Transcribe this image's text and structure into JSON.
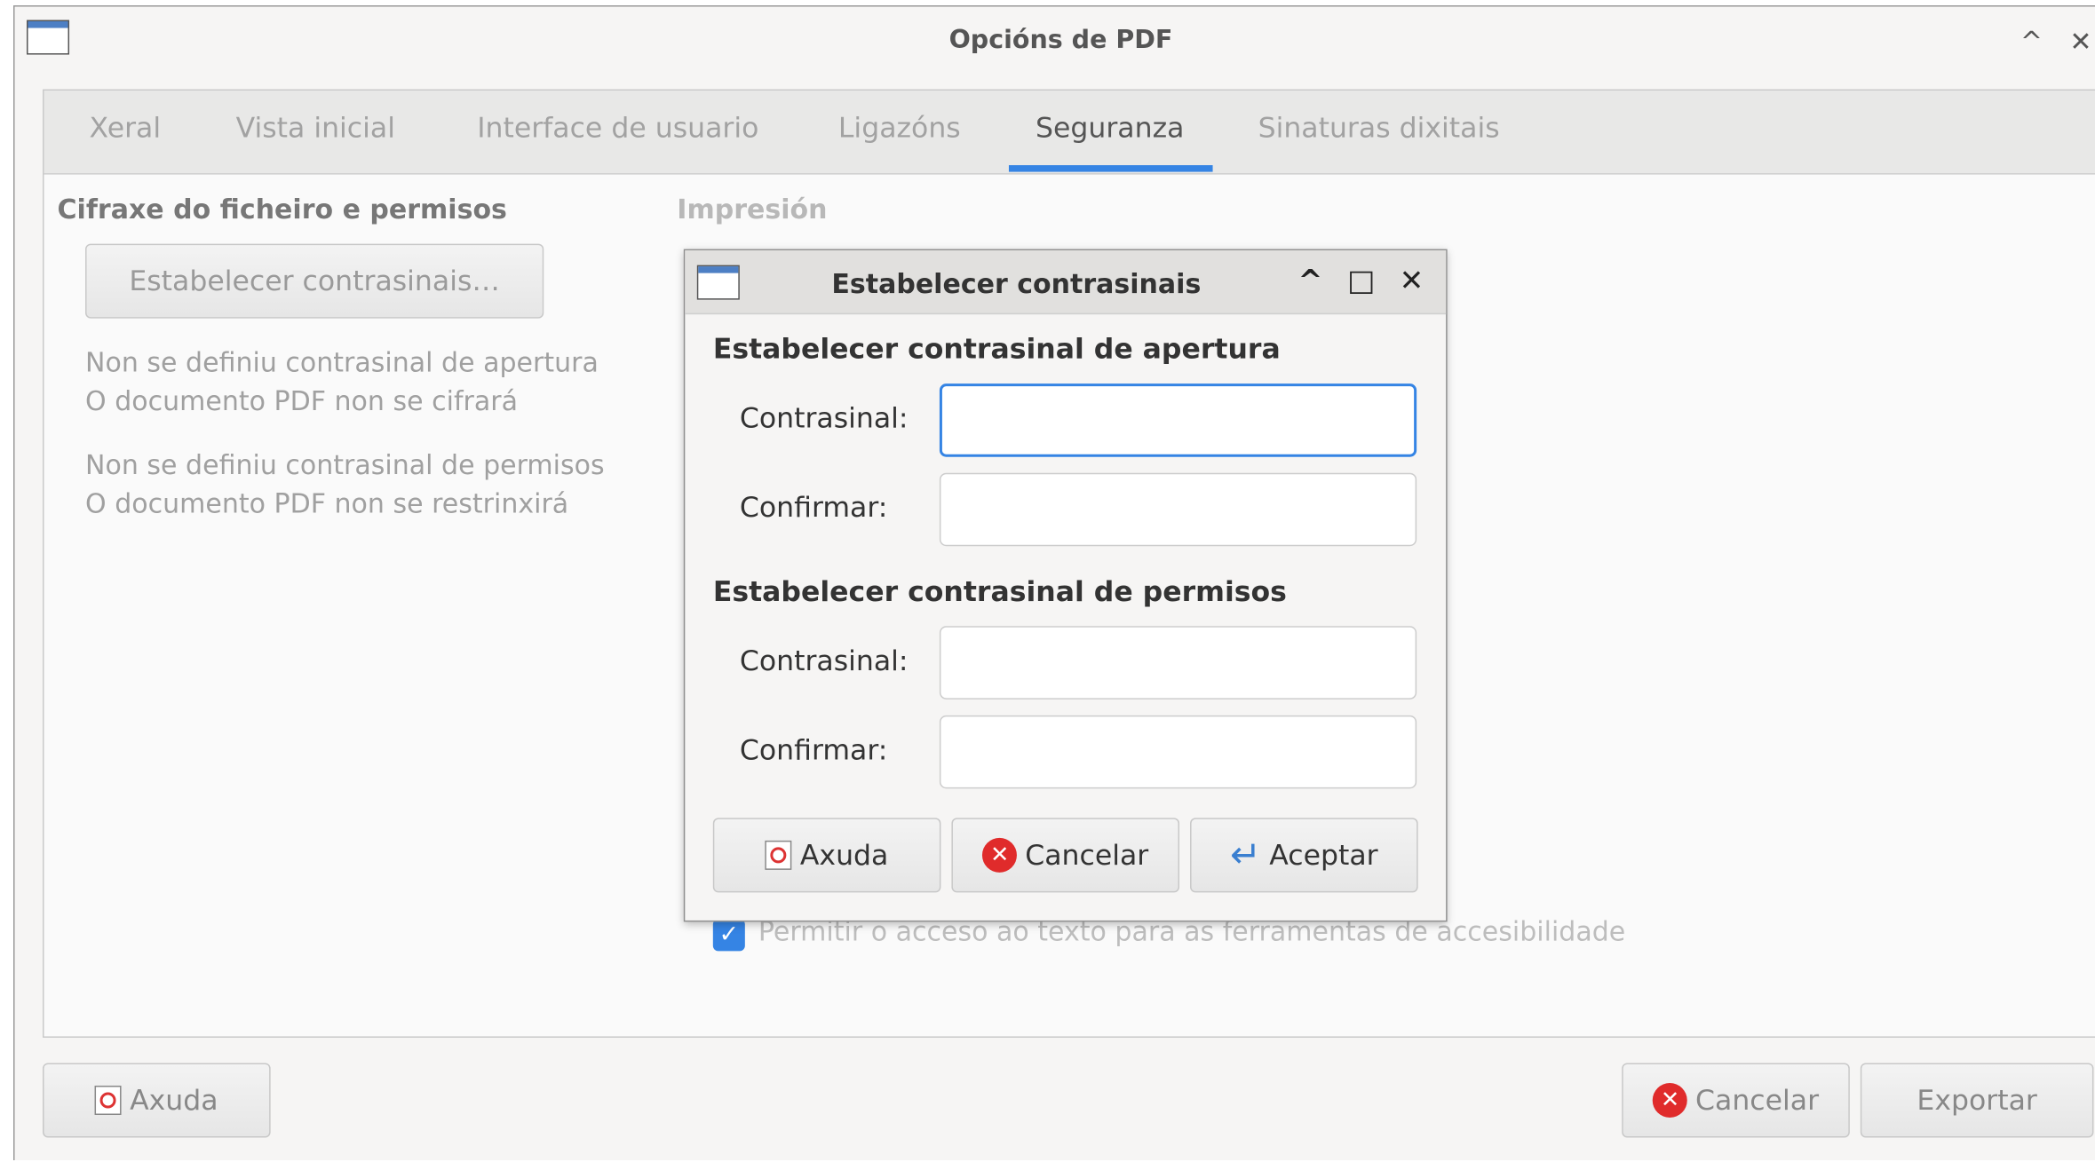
{
  "window": {
    "title": "Opcións de PDF",
    "controls": {
      "up": "^",
      "close": "✕"
    }
  },
  "tabs": [
    {
      "label": "Xeral"
    },
    {
      "label": "Vista inicial"
    },
    {
      "label": "Interface de usuario"
    },
    {
      "label": "Ligazóns"
    },
    {
      "label": "Seguranza",
      "active": true
    },
    {
      "label": "Sinaturas dixitais"
    }
  ],
  "security": {
    "heading": "Cifraxe do ficheiro e permisos",
    "set_passwords_button": "Estabelecer contrasinais…",
    "open_info_1": "Non se definiu contrasinal de apertura",
    "open_info_2": "O documento PDF non se cifrará",
    "perm_info_1": "Non se definiu contrasinal de permisos",
    "perm_info_2": "O documento PDF non se restrinxirá",
    "printing_heading": "Impresión",
    "accessibility_checkbox": "Permitir o acceso ao texto para as ferramentas de accesibilidade",
    "accessibility_checked": true
  },
  "footer": {
    "help": "Axuda",
    "cancel": "Cancelar",
    "export": "Exportar"
  },
  "dialog": {
    "title": "Estabelecer contrasinais",
    "controls": {
      "minimize": "^",
      "maximize": "□",
      "close": "✕"
    },
    "open_heading": "Estabelecer contrasinal de apertura",
    "perm_heading": "Estabelecer contrasinal de permisos",
    "password_label": "Contrasinal:",
    "confirm_label": "Confirmar:",
    "open_password_value": "",
    "open_confirm_value": "",
    "perm_password_value": "",
    "perm_confirm_value": "",
    "help": "Axuda",
    "cancel": "Cancelar",
    "accept": "Aceptar"
  },
  "colors": {
    "accent": "#3584e4",
    "cancel_icon": "#e02b2b"
  }
}
